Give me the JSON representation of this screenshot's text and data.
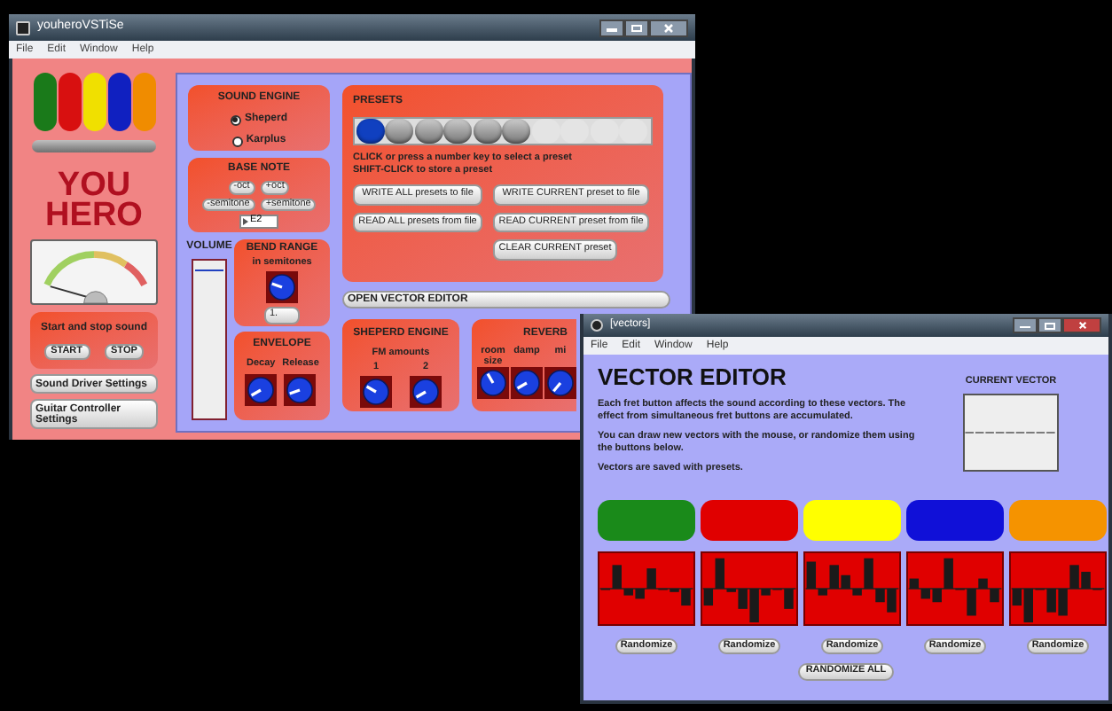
{
  "main_window": {
    "title": "youheroVSTiSe",
    "menu": [
      "File",
      "Edit",
      "Window",
      "Help"
    ],
    "frets": [
      {
        "color": "#1a7a1a"
      },
      {
        "color": "#d81010"
      },
      {
        "color": "#f0e000"
      },
      {
        "color": "#1020c0"
      },
      {
        "color": "#f08c00"
      }
    ],
    "logo": [
      "YOU",
      "HERO"
    ],
    "start_stop": {
      "label": "Start and stop sound",
      "buttons": [
        "START",
        "STOP"
      ]
    },
    "settings_buttons": [
      "Sound Driver Settings",
      "Guitar Controller Settings"
    ],
    "sound_engine": {
      "title": "SOUND ENGINE",
      "options": [
        {
          "label": "Sheperd",
          "selected": true
        },
        {
          "label": "Karplus",
          "selected": false
        }
      ]
    },
    "base_note": {
      "title": "BASE NOTE",
      "buttons": [
        "-oct",
        "+oct",
        "-semitone",
        "+semitone"
      ],
      "value": "E2"
    },
    "volume": {
      "label": "VOLUME",
      "level": 0.93
    },
    "bend_range": {
      "title": "BEND RANGE",
      "subtitle": "in semitones",
      "value": "1."
    },
    "envelope": {
      "title": "ENVELOPE",
      "knobs": [
        "Decay",
        "Release"
      ]
    },
    "presets": {
      "title": "PRESETS",
      "slots": [
        {
          "selected": true,
          "stored": true
        },
        {
          "selected": false,
          "stored": true
        },
        {
          "selected": false,
          "stored": true
        },
        {
          "selected": false,
          "stored": true
        },
        {
          "selected": false,
          "stored": true
        },
        {
          "selected": false,
          "stored": true
        },
        {
          "selected": false,
          "stored": false
        },
        {
          "selected": false,
          "stored": false
        },
        {
          "selected": false,
          "stored": false
        },
        {
          "selected": false,
          "stored": false
        }
      ],
      "hint": [
        "CLICK or press a number key to select a preset",
        "SHIFT-CLICK to store a preset"
      ],
      "buttons": [
        "WRITE ALL presets to file",
        "WRITE CURRENT preset to file",
        "READ ALL presets from file",
        "READ CURRENT preset from file",
        "CLEAR CURRENT preset"
      ]
    },
    "open_vector_editor": "OPEN VECTOR EDITOR",
    "sheperd_engine": {
      "title": "SHEPERD ENGINE",
      "subtitle": "FM amounts",
      "knobs": [
        "1",
        "2"
      ]
    },
    "reverb": {
      "title": "REVERB",
      "knobs": [
        "room size",
        "damp",
        "mi"
      ]
    }
  },
  "vector_window": {
    "title": "[vectors]",
    "menu": [
      "File",
      "Edit",
      "Window",
      "Help"
    ],
    "heading": "VECTOR EDITOR",
    "paragraphs": [
      "Each fret button affects the sound according to these vectors. The effect from simultaneous fret buttons are accumulated.",
      "You can draw new vectors with the mouse, or randomize them using the buttons below.",
      "Vectors are saved with presets."
    ],
    "current_vector": "CURRENT VECTOR",
    "vectors": [
      {
        "color": "#1a8a1a",
        "button": "Randomize"
      },
      {
        "color": "#e00000",
        "button": "Randomize"
      },
      {
        "color": "#ffff00",
        "button": "Randomize"
      },
      {
        "color": "#1010d8",
        "button": "Randomize"
      },
      {
        "color": "#f59300",
        "button": "Randomize"
      }
    ],
    "randomize_all": "RANDOMIZE ALL"
  }
}
